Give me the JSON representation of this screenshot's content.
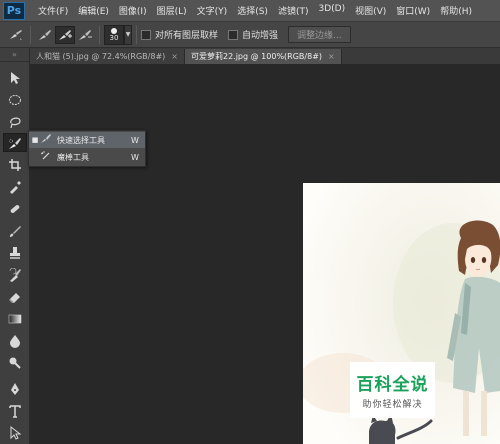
{
  "app": {
    "logo": "Ps"
  },
  "menu": [
    "文件(F)",
    "编辑(E)",
    "图像(I)",
    "图层(L)",
    "文字(Y)",
    "选择(S)",
    "滤镜(T)",
    "3D(D)",
    "视图(V)",
    "窗口(W)",
    "帮助(H)"
  ],
  "options": {
    "brush_size": "30",
    "sample_all_layers": "对所有图层取样",
    "auto_enhance": "自动增强",
    "refine_edge": "调整边缘..."
  },
  "tabs": [
    {
      "label": "人和猫 (5).jpg @ 72.4%(RGB/8#)",
      "active": false,
      "close": "×"
    },
    {
      "label": "可爱萝莉22.jpg @ 100%(RGB/8#)",
      "active": true,
      "close": "×"
    }
  ],
  "flyout": {
    "items": [
      {
        "label": "快速选择工具",
        "shortcut": "W",
        "selected": true,
        "mark": "■"
      },
      {
        "label": "魔棒工具",
        "shortcut": "W",
        "selected": false,
        "mark": ""
      }
    ]
  },
  "watermark": {
    "title": "百科全说",
    "subtitle": "助你轻松解决"
  },
  "colors": {
    "menubar": "#535353",
    "workspace": "#282828",
    "accent_green": "#1aa15a"
  }
}
